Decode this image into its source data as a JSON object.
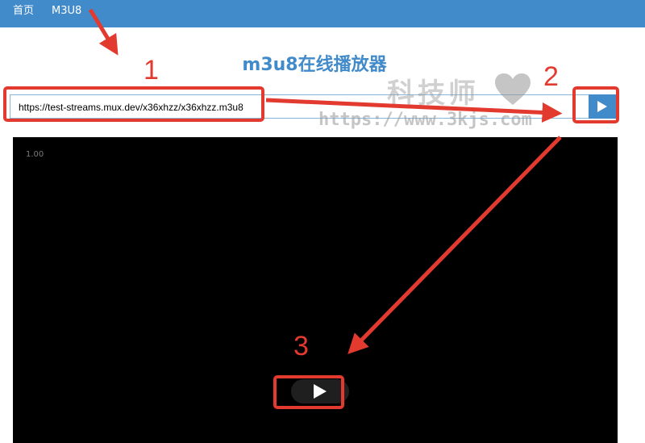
{
  "nav": {
    "home": "首页",
    "m3u8": "M3U8"
  },
  "page": {
    "title": "m3u8在线播放器"
  },
  "url_input": {
    "value": "https://test-streams.mux.dev/x36xhzz/x36xhzz.m3u8"
  },
  "player": {
    "speed": "1.00"
  },
  "watermark": {
    "name": "科技师",
    "url": "https://www.3kjs.com"
  },
  "annotations": {
    "step1": "1",
    "step2": "2",
    "step3": "3"
  },
  "colors": {
    "brand": "#428bca",
    "annotation": "#e23a2f",
    "player_bg": "#000000"
  },
  "icons": {
    "play_button": "play-icon",
    "big_play": "play-icon",
    "watermark": "heart-icon"
  }
}
